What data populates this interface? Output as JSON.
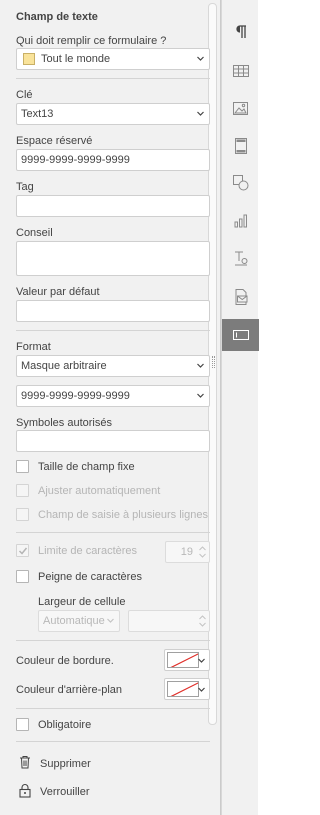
{
  "panel": {
    "title": "Champ de texte",
    "who_label": "Qui doit remplir ce formulaire ?",
    "who_value": "Tout le monde",
    "who_color": "#f9e39a",
    "key_label": "Clé",
    "key_value": "Text13",
    "placeholder_label": "Espace réservé",
    "placeholder_value": "9999-9999-9999-9999",
    "tag_label": "Tag",
    "tag_value": "",
    "hint_label": "Conseil",
    "hint_value": "",
    "default_label": "Valeur par défaut",
    "default_value": "",
    "format_label": "Format",
    "format_value": "Masque arbitraire",
    "mask_value": "9999-9999-9999-9999",
    "allowed_label": "Symboles autorisés",
    "allowed_value": "",
    "fixed_size_label": "Taille de champ fixe",
    "autofit_label": "Ajuster automatiquement",
    "multiline_label": "Champ de saisie à plusieurs lignes",
    "char_limit_label": "Limite de caractères",
    "char_limit_value": "19",
    "comb_label": "Peigne de caractères",
    "cell_width_label": "Largeur de cellule",
    "cell_width_value": "Automatique",
    "cell_width_number": "",
    "border_color_label": "Couleur de bordure.",
    "bg_color_label": "Couleur d'arrière-plan",
    "required_label": "Obligatoire",
    "delete_label": "Supprimer",
    "lock_label": "Verrouiller"
  },
  "checkboxes": {
    "fixed_size": false,
    "autofit": false,
    "multiline": false,
    "char_limit": true,
    "comb": false,
    "required": false
  },
  "rightbar": {
    "items": [
      "paragraph-icon",
      "table-icon",
      "image-icon",
      "header-footer-icon",
      "shape-icon",
      "chart-icon",
      "text-art-icon",
      "mail-merge-icon",
      "form-field-icon"
    ],
    "active": "form-field-icon"
  },
  "colors": {
    "accent_active": "#7c7c7c",
    "no_color_line": "#e0302a"
  }
}
